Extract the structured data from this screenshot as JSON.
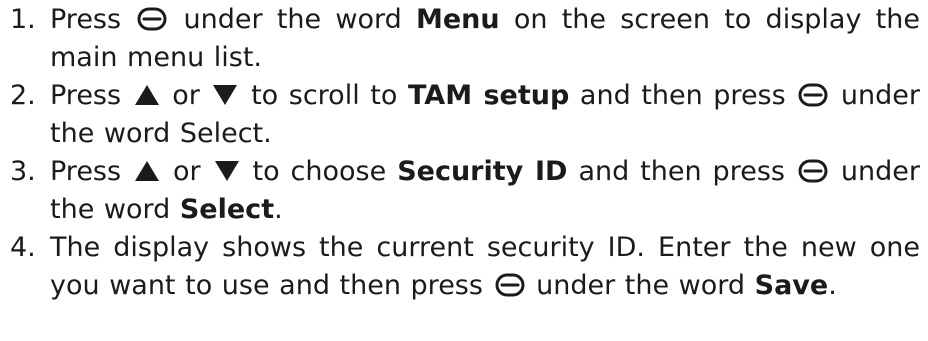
{
  "steps": [
    {
      "number": "1.",
      "press": "Press",
      "after_icon": "under the word",
      "bold_term": "Menu",
      "rest": "on the screen to display the main menu list."
    },
    {
      "number": "2.",
      "press": "Press",
      "or": "or",
      "to_scroll": "to scroll to",
      "bold_term": "TAM setup",
      "then_press": "and then press",
      "tail": "under the word Select."
    },
    {
      "number": "3.",
      "press": "Press",
      "or": "or",
      "to_choose": "to choose",
      "bold_term": "Security ID",
      "then_press": "and then press",
      "under_word": "under the word",
      "bold_term_2": "Select",
      "period": "."
    },
    {
      "number": "4.",
      "lead": "The display shows the current security ID. Enter the new one you want to use and then press",
      "under_word": "under the word",
      "bold_term": "Save",
      "period": "."
    }
  ],
  "icons": {
    "soft_key": "soft-key-button-icon",
    "up": "up-arrow-icon",
    "down": "down-arrow-icon"
  }
}
